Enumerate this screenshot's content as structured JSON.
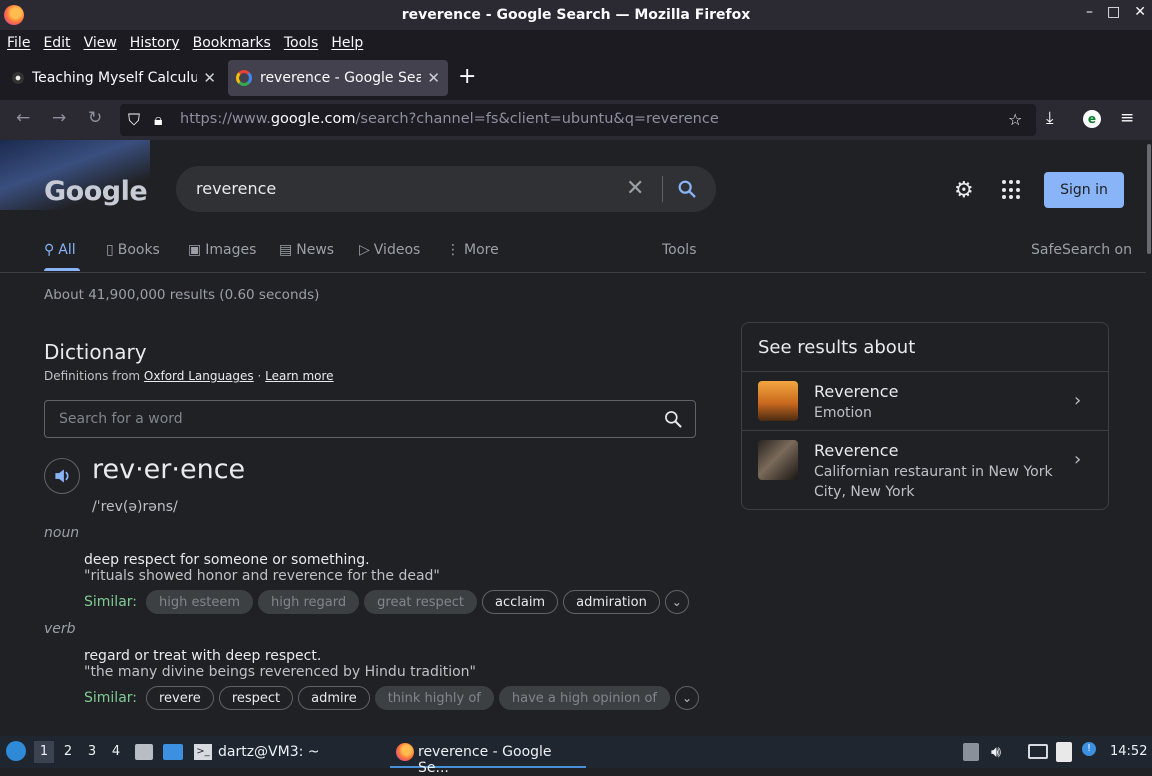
{
  "window": {
    "title": "reverence - Google Search — Mozilla Firefox",
    "controls": [
      "–",
      "□",
      "✕"
    ]
  },
  "menu": [
    "File",
    "Edit",
    "View",
    "History",
    "Bookmarks",
    "Tools",
    "Help"
  ],
  "tabs": [
    {
      "label": "Teaching Myself Calculus",
      "close": "✕"
    },
    {
      "label": "reverence - Google Search",
      "close": "✕"
    }
  ],
  "newtab": "+",
  "url": {
    "prefix": "https://www.",
    "host": "google.com",
    "path": "/search?channel=fs&client=ubuntu&q=reverence"
  },
  "google": {
    "logo": "Google",
    "query": "reverence",
    "signin": "Sign in",
    "tabs": {
      "all": "All",
      "books": "Books",
      "images": "Images",
      "news": "News",
      "videos": "Videos",
      "more": "More",
      "tools": "Tools",
      "safesearch": "SafeSearch on"
    },
    "stats": "About 41,900,000 results (0.60 seconds)"
  },
  "dictionary": {
    "title": "Dictionary",
    "sub_prefix": "Definitions from ",
    "source": "Oxford Languages",
    "sep": " · ",
    "learn": "Learn more",
    "search_placeholder": "Search for a word",
    "word": "rev·er·ence",
    "phonetic": "/ˈrev(ə)rəns/",
    "noun": {
      "pos": "noun",
      "def": "deep respect for someone or something.",
      "example": "\"rituals showed honor and reverence for the dead\"",
      "similar_label": "Similar:",
      "similar": [
        "high esteem",
        "high regard",
        "great respect",
        "acclaim",
        "admiration"
      ]
    },
    "verb": {
      "pos": "verb",
      "def": "regard or treat with deep respect.",
      "example": "\"the many divine beings reverenced by Hindu tradition\"",
      "similar_label": "Similar:",
      "similar": [
        "revere",
        "respect",
        "admire",
        "think highly of",
        "have a high opinion of"
      ]
    }
  },
  "knowledge": {
    "title": "See results about",
    "items": [
      {
        "name": "Reverence",
        "desc": "Emotion"
      },
      {
        "name": "Reverence",
        "desc": "Californian restaurant in New York City, New York"
      }
    ]
  },
  "taskbar": {
    "workspaces": [
      "1",
      "2",
      "3",
      "4"
    ],
    "terminal": "dartz@VM3: ~",
    "firefox": "reverence - Google Se...",
    "clock": "14:52"
  }
}
